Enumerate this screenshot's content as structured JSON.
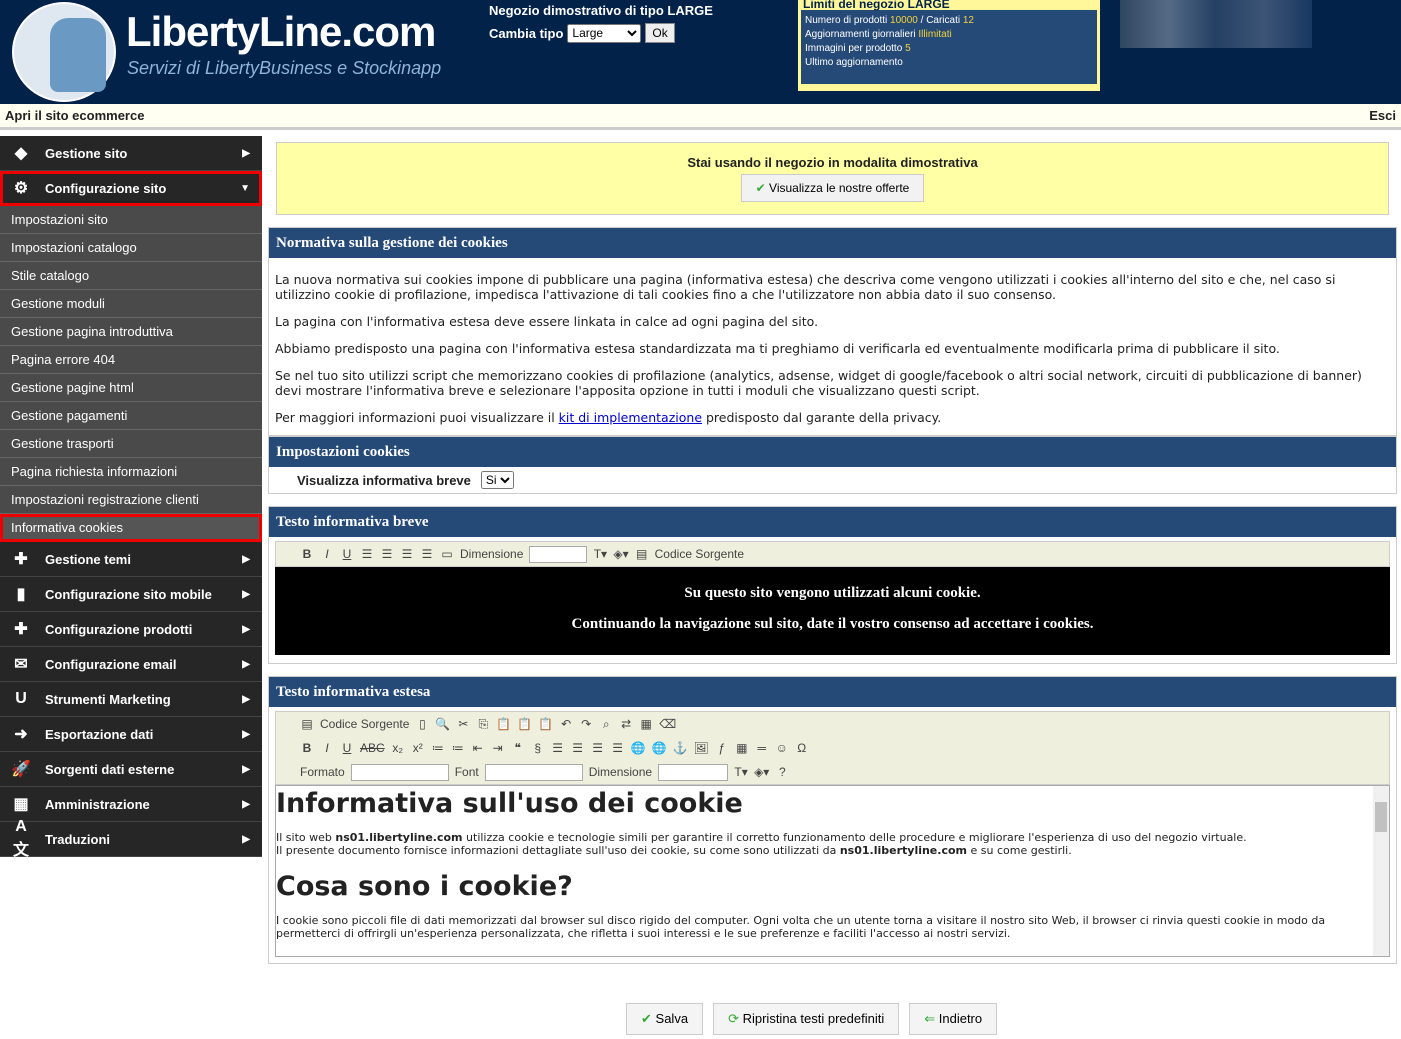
{
  "header": {
    "brand": "LibertyLine.com",
    "slogan": "Servizi di LibertyBusiness e Stockinapp",
    "demo_title": "Negozio dimostrativo di tipo LARGE",
    "cambia_label": "Cambia tipo",
    "tipo_value": "Large",
    "ok_label": "Ok",
    "limits": {
      "title": "Limiti del negozio LARGE",
      "prodotti_label": "Numero di prodotti",
      "prodotti": "10000",
      "caricati_label": "/ Caricati",
      "caricati": "12",
      "agg_label": "Aggiornamenti giornalieri",
      "agg": "Illimitati",
      "img_label": "Immagini per prodotto",
      "img": "5",
      "ultimo_label": "Ultimo aggiornamento"
    }
  },
  "topbar": {
    "open_site": "Apri il sito ecommerce",
    "logout": "Esci"
  },
  "sidebar": {
    "top": [
      {
        "label": "Gestione sito",
        "icon": "diamond-icon"
      },
      {
        "label": "Configurazione sito",
        "icon": "gear-icon"
      }
    ],
    "sub": [
      "Impostazioni sito",
      "Impostazioni catalogo",
      "Stile catalogo",
      "Gestione moduli",
      "Gestione pagina introduttiva",
      "Pagina errore 404",
      "Gestione pagine html",
      "Gestione pagamenti",
      "Gestione trasporti",
      "Pagina richiesta informazioni",
      "Impostazioni registrazione clienti",
      "Informativa cookies"
    ],
    "bottom": [
      {
        "label": "Gestione temi",
        "icon": "puzzle-icon"
      },
      {
        "label": "Configurazione sito mobile",
        "icon": "mobile-icon"
      },
      {
        "label": "Configurazione prodotti",
        "icon": "puzzle-icon"
      },
      {
        "label": "Configurazione email",
        "icon": "envelope-icon"
      },
      {
        "label": "Strumenti Marketing",
        "icon": "magnet-icon"
      },
      {
        "label": "Esportazione dati",
        "icon": "arrow-right-icon"
      },
      {
        "label": "Sorgenti dati esterne",
        "icon": "rocket-icon"
      },
      {
        "label": "Amministrazione",
        "icon": "building-icon"
      },
      {
        "label": "Traduzioni",
        "icon": "translate-icon"
      }
    ]
  },
  "demo": {
    "text": "Stai usando il negozio in modalita dimostrativa",
    "button": "Visualizza le nostre offerte"
  },
  "normativa": {
    "title": "Normativa sulla gestione dei cookies",
    "p1": "La nuova normativa sui cookies impone di pubblicare una pagina (informativa estesa) che descriva come vengono utilizzati i cookies all'interno del sito e che, nel caso si utilizzino cookie di profilazione, impedisca l'attivazione di tali cookies fino a che l'utilizzatore non abbia dato il suo consenso.",
    "p2": "La pagina con l'informativa estesa deve essere linkata in calce ad ogni pagina del sito.",
    "p3": "Abbiamo predisposto una pagina con l'informativa estesa standardizzata ma ti preghiamo di verificarla ed eventualmente modificarla prima di pubblicare il sito.",
    "p4": "Se nel tuo sito utilizzi script che memorizzano cookies di profilazione (analytics, adsense, widget di google/facebook o altri social network, circuiti di pubblicazione di banner) devi mostrare l'informativa breve e selezionare l'apposita opzione in tutti i moduli che visualizzano questi script.",
    "p5_pre": "Per maggiori informazioni puoi visualizzare il ",
    "p5_link": "kit di implementazione",
    "p5_post": " predisposto dal garante della privacy."
  },
  "impostazioni": {
    "title": "Impostazioni cookies",
    "label": "Visualizza informativa breve",
    "value": "Si"
  },
  "breve": {
    "title": "Testo informativa breve",
    "dimensione": "Dimensione",
    "codice": "Codice Sorgente",
    "line1": "Su questo sito vengono utilizzati alcuni cookie.",
    "line2": "Continuando la navigazione sul sito, date il vostro consenso ad accettare i cookies."
  },
  "estesa": {
    "title": "Testo informativa estesa",
    "codice": "Codice Sorgente",
    "formato": "Formato",
    "font": "Font",
    "dimensione": "Dimensione",
    "h1": "Informativa sull'uso dei cookie",
    "p1a": "Il sito web ",
    "site": "ns01.libertyline.com",
    "p1b": " utilizza cookie e tecnologie simili per garantire il corretto funzionamento delle procedure e migliorare l'esperienza di uso del negozio virtuale.",
    "p1c": "Il presente documento fornisce informazioni dettagliate sull'uso dei cookie, su come sono utilizzati da ",
    "p1d": " e su come gestirli.",
    "h2": "Cosa sono i cookie?",
    "p2": "I cookie sono piccoli file di dati memorizzati dal browser sul disco rigido del computer. Ogni volta che un utente torna a visitare il nostro sito Web, il browser ci rinvia questi cookie in modo da permetterci di offrirgli un'esperienza personalizzata, che rifletta i suoi interessi e le sue preferenze e faciliti l'accesso ai nostri servizi."
  },
  "actions": {
    "save": "Salva",
    "reset": "Ripristina testi predefiniti",
    "back": "Indietro"
  }
}
